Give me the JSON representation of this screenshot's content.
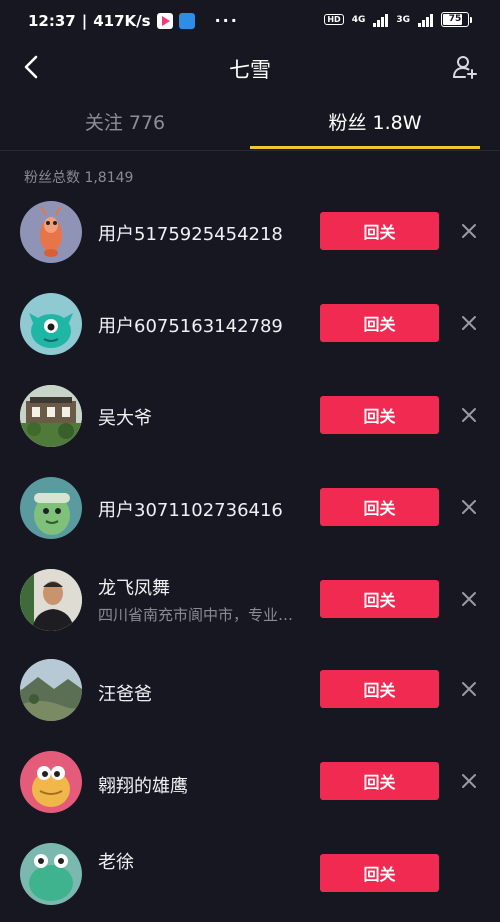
{
  "status_bar": {
    "time": "12:37",
    "net_speed": "417K/s",
    "more": "···",
    "hd": "HD",
    "signal1_label": "4G",
    "signal2_label": "3G",
    "battery": "75"
  },
  "header": {
    "title": "七雪"
  },
  "tabs": [
    {
      "label": "关注 776",
      "active": false
    },
    {
      "label": "粉丝 1.8W",
      "active": true
    }
  ],
  "summary": "粉丝总数 1,8149",
  "followers": [
    {
      "name": "用户5175925454218",
      "subtitle": "",
      "button": "回关",
      "avatar": "shrimp-avatar"
    },
    {
      "name": "用户6075163142789",
      "subtitle": "",
      "button": "回关",
      "avatar": "green-monster-avatar"
    },
    {
      "name": "吴大爷",
      "subtitle": "",
      "button": "回关",
      "avatar": "building-photo-avatar"
    },
    {
      "name": "用户3071102736416",
      "subtitle": "",
      "button": "回关",
      "avatar": "green-blob-avatar"
    },
    {
      "name": "龙飞凤舞",
      "subtitle": "四川省南充市阆中市，专业…",
      "button": "回关",
      "avatar": "man-photo-avatar"
    },
    {
      "name": "汪爸爸",
      "subtitle": "",
      "button": "回关",
      "avatar": "landscape-photo-avatar"
    },
    {
      "name": "翱翔的雄鹰",
      "subtitle": "",
      "button": "回关",
      "avatar": "yellow-monster-avatar"
    },
    {
      "name": "老徐",
      "subtitle": "",
      "button": "回关",
      "avatar": "teal-frog-avatar"
    }
  ],
  "colors": {
    "background": "#171722",
    "accent_button": "#f02a51",
    "tab_indicator": "#f2c336"
  }
}
